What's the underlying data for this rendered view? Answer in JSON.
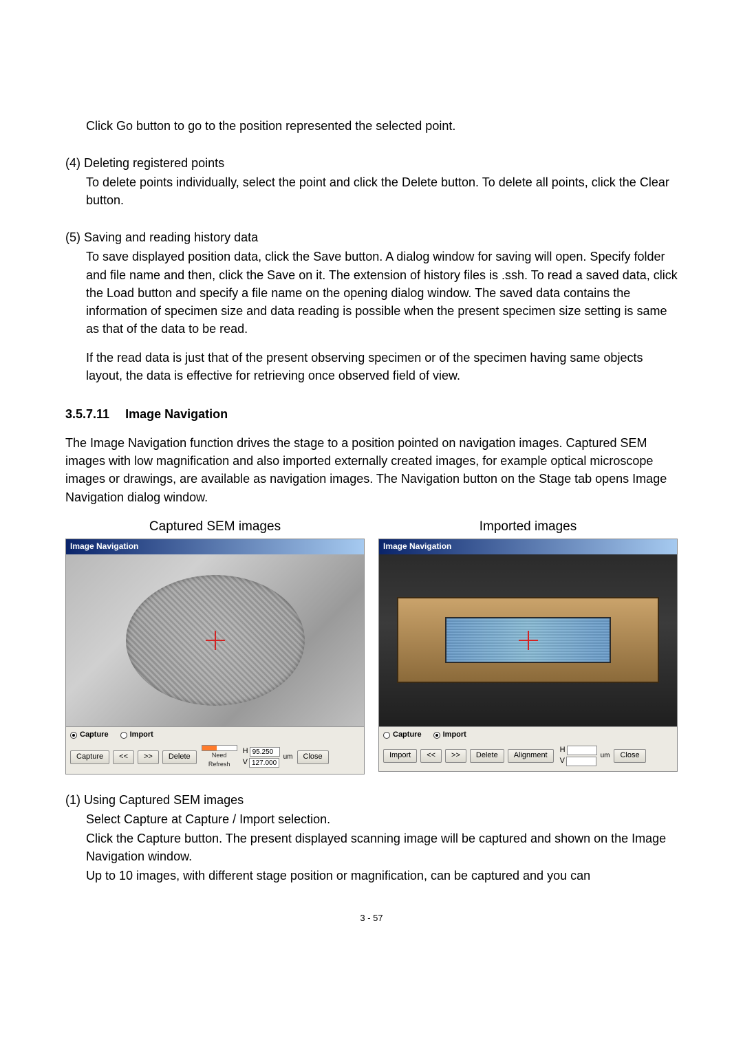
{
  "body": {
    "p1": "Click Go button to go to the position represented the selected point.",
    "item4_head": "(4) Deleting registered points",
    "item4_body": "To delete points individually, select the point and click the Delete button. To delete all points, click the Clear button.",
    "item5_head": "(5) Saving and reading history data",
    "item5_body1": "To save displayed position data, click the Save button. A dialog window for saving will open. Specify folder and file name and then, click the Save on it. The extension of history files is .ssh. To read a saved data, click the Load button and specify a file name on the opening dialog window. The saved data contains the information of specimen size and data reading is possible when the present specimen size setting is same as that of the data to be read.",
    "item5_body2": "If the read data is just that of the present observing specimen or of the specimen having same objects layout, the data is effective for retrieving once observed field of view.",
    "section_no": "3.5.7.11",
    "section_title": "Image Navigation",
    "intro": "The Image Navigation function drives the stage to a position pointed on navigation images. Captured SEM images with low magnification and also imported externally created images, for example optical microscope images or drawings, are available as navigation images. The Navigation button on the Stage tab opens Image Navigation dialog window.",
    "sub1_head": "(1) Using Captured SEM images",
    "sub1_line1": "Select Capture at Capture / Import selection.",
    "sub1_line2": "Click the Capture button. The present displayed scanning image will be captured and shown on the Image Navigation window.",
    "sub1_line3": "Up to 10 images, with different stage position or magnification, can be captured and you can"
  },
  "captions": {
    "left": "Captured SEM images",
    "right": "Imported images"
  },
  "panelLeft": {
    "title": "Image Navigation",
    "radio_capture": "Capture",
    "radio_import": "Import",
    "btn_capture": "Capture",
    "btn_prev": "<<",
    "btn_next": ">>",
    "btn_delete": "Delete",
    "need_refresh": "Need Refresh",
    "H": "H",
    "V": "V",
    "h_value": "95.250",
    "v_value": "127.000",
    "unit": "um",
    "btn_close": "Close"
  },
  "panelRight": {
    "title": "Image Navigation",
    "radio_capture": "Capture",
    "radio_import": "Import",
    "btn_import": "Import",
    "btn_prev": "<<",
    "btn_next": ">>",
    "btn_delete": "Delete",
    "btn_align": "Alignment",
    "H": "H",
    "V": "V",
    "unit": "um",
    "btn_close": "Close"
  },
  "footer": {
    "page": "3 - 57"
  }
}
